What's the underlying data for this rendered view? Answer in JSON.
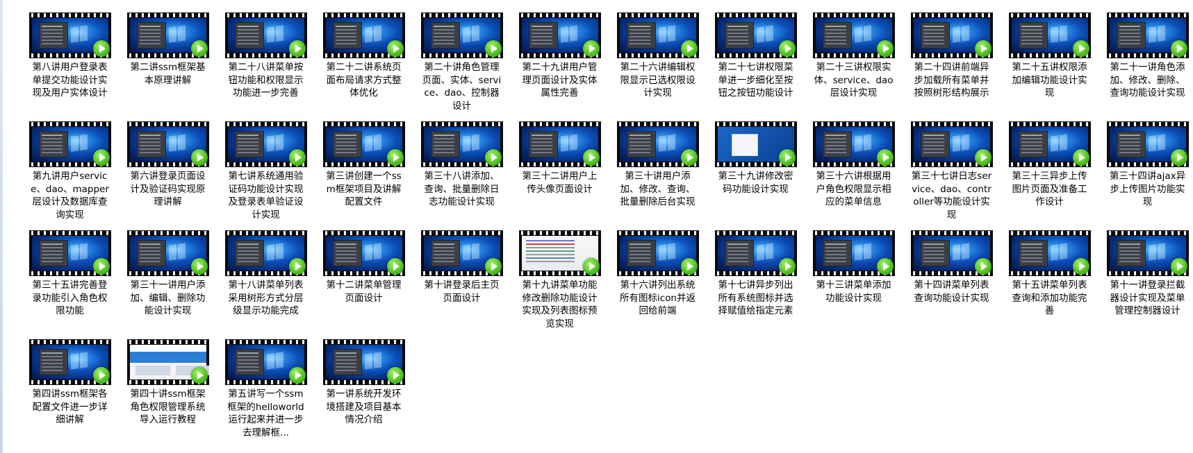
{
  "files": [
    {
      "name": "第八讲用户登录表单提交功能设计实现及用户实体设计",
      "thumb": "desktop"
    },
    {
      "name": "第二讲ssm框架基本原理讲解",
      "thumb": "desktop"
    },
    {
      "name": "第二十八讲菜单按钮功能和权限显示功能进一步完善",
      "thumb": "desktop"
    },
    {
      "name": "第二十二讲系统页面布局请求方式整体优化",
      "thumb": "desktop"
    },
    {
      "name": "第二十讲角色管理页面、实体、service、dao、控制器设计",
      "thumb": "desktop"
    },
    {
      "name": "第二十九讲用户管理页面设计及实体属性完善",
      "thumb": "desktop"
    },
    {
      "name": "第二十六讲编辑权限显示已选权限设计实现",
      "thumb": "desktop"
    },
    {
      "name": "第二十七讲权限菜单进一步细化至按钮之按钮功能设计",
      "thumb": "desktop"
    },
    {
      "name": "第二十三讲权限实体、service、dao层设计实现",
      "thumb": "desktop"
    },
    {
      "name": "第二十四讲前端异步加载所有菜单并按照树形结构展示",
      "thumb": "desktop"
    },
    {
      "name": "第二十五讲权限添加编辑功能设计实现",
      "thumb": "desktop"
    },
    {
      "name": "第二十一讲角色添加、修改、删除、查询功能设计实现",
      "thumb": "desktop"
    },
    {
      "name": "第九讲用户service、dao、mapper层设计及数据库查询实现",
      "thumb": "desktop"
    },
    {
      "name": "第六讲登录页面设计及验证码实现原理讲解",
      "thumb": "desktop"
    },
    {
      "name": "第七讲系统通用验证码功能设计实现及登录表单验证设计实现",
      "thumb": "desktop"
    },
    {
      "name": "第三讲创建一个ssm框架项目及讲解配置文件",
      "thumb": "desktop"
    },
    {
      "name": "第三十八讲添加、查询、批量删除日志功能设计实现",
      "thumb": "desktop"
    },
    {
      "name": "第三十二讲用户上传头像页面设计",
      "thumb": "desktop"
    },
    {
      "name": "第三十讲用户添加、修改、查询、批量删除后台实现",
      "thumb": "desktop"
    },
    {
      "name": "第三十九讲修改密码功能设计实现",
      "thumb": "dialog"
    },
    {
      "name": "第三十六讲根据用户角色权限显示相应的菜单信息",
      "thumb": "desktop"
    },
    {
      "name": "第三十七讲日志service、dao、controller等功能设计实现",
      "thumb": "desktop"
    },
    {
      "name": "第三十三异步上传图片页面及准备工作设计",
      "thumb": "desktop"
    },
    {
      "name": "第三十四讲ajax异步上传图片功能实现",
      "thumb": "desktop"
    },
    {
      "name": "第三十五讲完善登录功能引入角色权限功能",
      "thumb": "desktop"
    },
    {
      "name": "第三十一讲用户添加、编辑、删除功能设计实现",
      "thumb": "desktop"
    },
    {
      "name": "第十八讲菜单列表采用树形方式分层级显示功能完成",
      "thumb": "desktop"
    },
    {
      "name": "第十二讲菜单管理页面设计",
      "thumb": "desktop"
    },
    {
      "name": "第十讲登录后主页页面设计",
      "thumb": "desktop"
    },
    {
      "name": "第十九讲菜单功能修改删除功能设计实现及列表图标预览实现",
      "thumb": "code"
    },
    {
      "name": "第十六讲列出系统所有图标icon并返回给前端",
      "thumb": "desktop"
    },
    {
      "name": "第十七讲异步列出所有系统图标并选择赋值给指定元素",
      "thumb": "desktop"
    },
    {
      "name": "第十三讲菜单添加功能设计实现",
      "thumb": "desktop"
    },
    {
      "name": "第十四讲菜单列表查询功能设计实现",
      "thumb": "desktop"
    },
    {
      "name": "第十五讲菜单列表查询和添加功能完善",
      "thumb": "desktop"
    },
    {
      "name": "第十一讲登录拦截器设计实现及菜单管理控制器设计",
      "thumb": "desktop"
    },
    {
      "name": "第四讲ssm框架各配置文件进一步详细讲解",
      "thumb": "desktop"
    },
    {
      "name": "第四十讲ssm框架角色权限管理系统导入运行教程",
      "thumb": "web"
    },
    {
      "name": "第五讲写一个ssm框架的helloworld运行起来并进一步去理解框...",
      "thumb": "desktop"
    },
    {
      "name": "第一讲系统开发环境搭建及项目基本情况介绍",
      "thumb": "desktop"
    }
  ]
}
